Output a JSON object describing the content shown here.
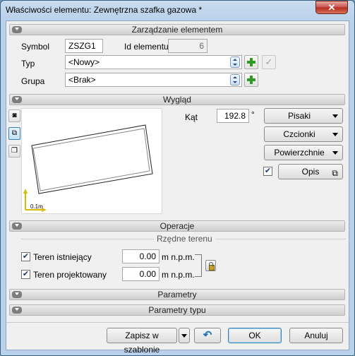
{
  "window": {
    "title": "Właściwości elementu: Zewnętrzna szafka gazowa *",
    "close_label": "✕"
  },
  "sections": {
    "management": "Zarządzanie elementem",
    "appearance": "Wygląd",
    "operations": "Operacje",
    "terrain_group": "Rzędne terenu",
    "parameters": "Parametry",
    "type_parameters": "Parametry typu"
  },
  "management": {
    "symbol_label": "Symbol",
    "symbol_value": "ZSZG1",
    "id_label": "Id elementu",
    "id_value": "6",
    "type_label": "Typ",
    "type_value": "<Nowy>",
    "group_label": "Grupa",
    "group_value": "<Brak>"
  },
  "appearance": {
    "angle_label": "Kąt",
    "angle_value": "192.8",
    "angle_unit": "°",
    "pens_button": "Pisaki",
    "fonts_button": "Czcionki",
    "surfaces_button": "Powierzchnie",
    "description_button": "Opis",
    "description_checked": true,
    "scale_label": "0.1m"
  },
  "operations": {
    "existing_terrain_label": "Teren istniejący",
    "existing_terrain_value": "0.00",
    "existing_terrain_checked": true,
    "designed_terrain_label": "Teren projektowany",
    "designed_terrain_value": "0.00",
    "designed_terrain_checked": true,
    "unit": "m n.p.m."
  },
  "footer": {
    "save_template_label": "Zapisz w szablonie",
    "ok_label": "OK",
    "cancel_label": "Anuluj"
  },
  "colors": {
    "accent": "#3c7fb1",
    "add_green": "#2f9a24",
    "axis_yellow": "#d9b800"
  }
}
